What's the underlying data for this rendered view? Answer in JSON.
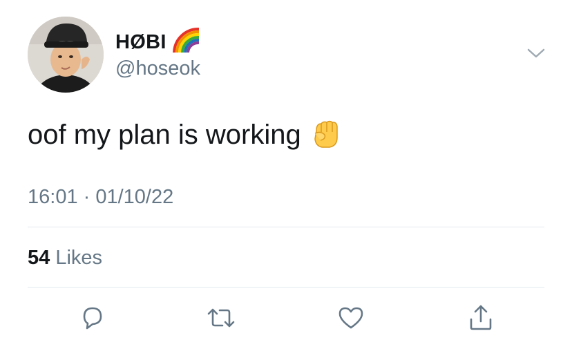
{
  "author": {
    "display_name": "HØBI",
    "badge_icon": "rainbow-icon",
    "handle": "@hoseok"
  },
  "tweet": {
    "text": "oof my plan is working",
    "emoji_icon": "raised-fist-icon",
    "timestamp": "16:01 · 01/10/22"
  },
  "stats": {
    "likes_count": "54",
    "likes_label": "Likes"
  },
  "actions": [
    {
      "icon": "reply-icon"
    },
    {
      "icon": "retweet-icon"
    },
    {
      "icon": "heart-icon"
    },
    {
      "icon": "share-icon"
    }
  ],
  "menu": {
    "icon": "chevron-down-icon"
  },
  "colors": {
    "primary_text": "#14171a",
    "secondary_text": "#657786",
    "divider": "#e1e8ed",
    "icon": "#657786"
  }
}
